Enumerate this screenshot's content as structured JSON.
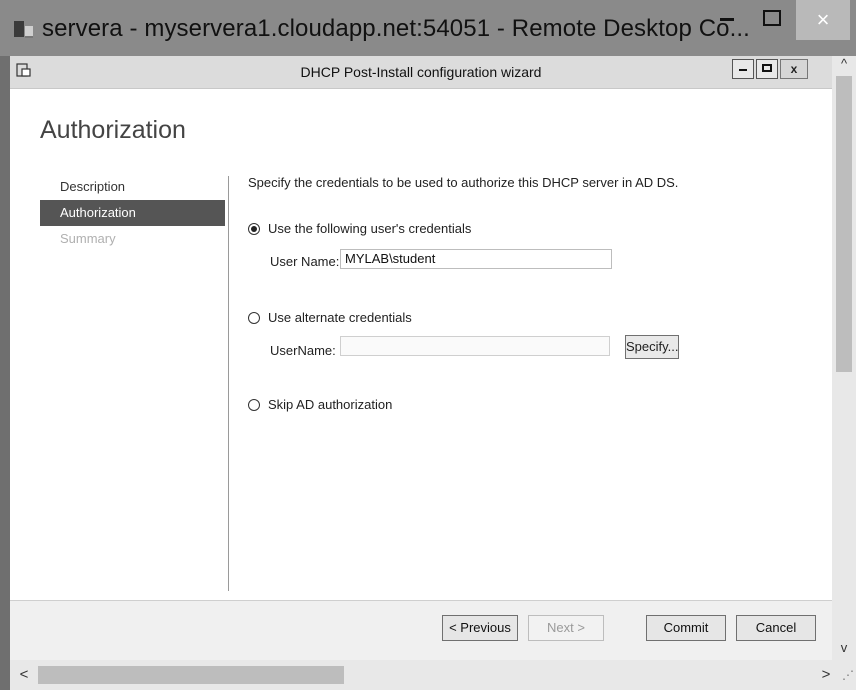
{
  "rdp_window": {
    "title": "servera - myservera1.cloudapp.net:54051 - Remote Desktop Co...",
    "minimize_icon": "minimize-icon",
    "maximize_icon": "maximize-icon",
    "close_icon": "close-icon",
    "close_glyph": "×"
  },
  "wizard": {
    "window_title": "DHCP Post-Install configuration wizard",
    "close_glyph": "x",
    "page_title": "Authorization",
    "nav": [
      {
        "label": "Description",
        "state": "normal"
      },
      {
        "label": "Authorization",
        "state": "active"
      },
      {
        "label": "Summary",
        "state": "disabled"
      }
    ],
    "intro": "Specify the credentials to be used to authorize this DHCP server in AD DS.",
    "options": {
      "use_user": {
        "label": "Use the following user's credentials",
        "checked": true,
        "field_label": "User Name:",
        "field_value": "MYLAB\\student"
      },
      "alternate": {
        "label": "Use alternate credentials",
        "checked": false,
        "field_label": "UserName:",
        "field_value": "",
        "specify_button": "Specify..."
      },
      "skip": {
        "label": "Skip AD authorization",
        "checked": false
      }
    },
    "buttons": {
      "previous": "< Previous",
      "next": "Next >",
      "commit": "Commit",
      "cancel": "Cancel"
    }
  },
  "scrollbars": {
    "up": "^",
    "down": "v",
    "left": "<",
    "right": ">"
  },
  "colors": {
    "active_nav_bg": "#555555",
    "titlebar_bg": "#8a8a8a"
  }
}
